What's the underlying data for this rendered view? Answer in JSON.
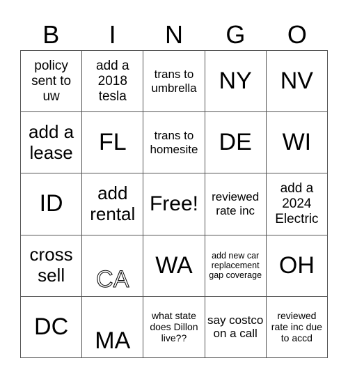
{
  "header": [
    "B",
    "I",
    "N",
    "G",
    "O"
  ],
  "cells": [
    [
      "policy sent to uw",
      "add a 2018 tesla",
      "trans to umbrella",
      "NY",
      "NV"
    ],
    [
      "add a lease",
      "FL",
      "trans to homesite",
      "DE",
      "WI"
    ],
    [
      "ID",
      "add rental",
      "Free!",
      "reviewed rate inc",
      "add a 2024 Electric"
    ],
    [
      "cross sell",
      "CA",
      "WA",
      "add new car replacement gap coverage",
      "OH"
    ],
    [
      "DC",
      "MA",
      "what state does Dillon live??",
      "say costco on a call",
      "reviewed rate inc due to accd"
    ]
  ]
}
